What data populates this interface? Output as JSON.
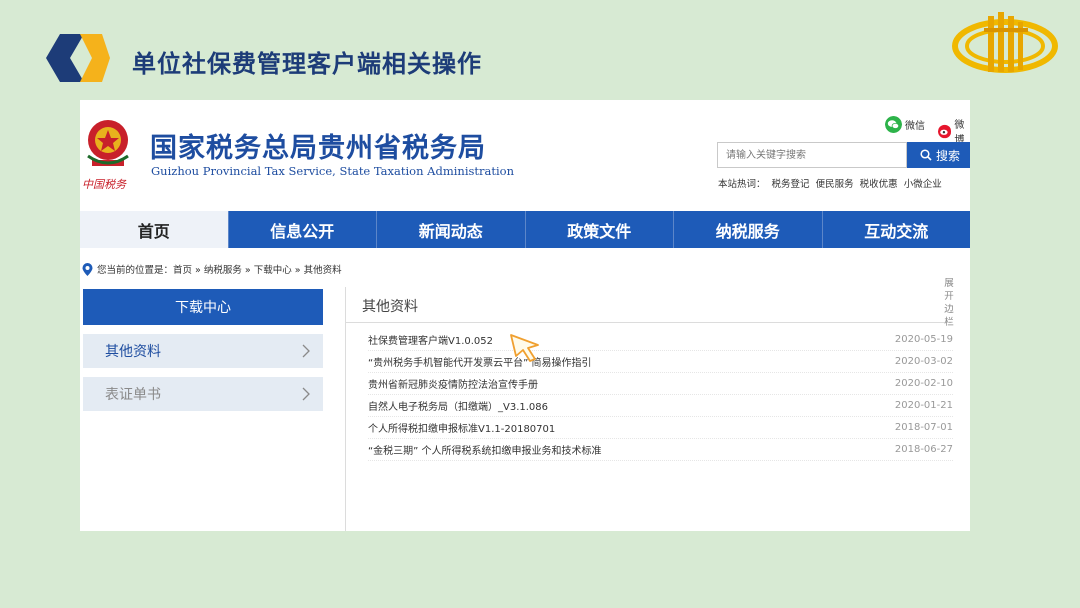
{
  "slide": {
    "title": "单位社保费管理客户端相关操作",
    "accent_colors": {
      "navy": "#1d3c78",
      "gold": "#f5b21b",
      "blue": "#1e5bb8"
    }
  },
  "site": {
    "name_cn": "国家税务总局贵州省税务局",
    "name_en": "Guizhou Provincial Tax Service, State Taxation Administration",
    "badge_text": "中国税务",
    "social": [
      {
        "icon": "wechat-icon",
        "label": "微信"
      },
      {
        "icon": "weibo-icon",
        "label": "微博"
      }
    ],
    "search": {
      "placeholder": "请输入关键字搜索",
      "button_label": "搜索"
    },
    "hot_label": "本站热词：",
    "hot_words": [
      "税务登记",
      "便民服务",
      "税收优惠",
      "小微企业"
    ],
    "nav": [
      "首页",
      "信息公开",
      "新闻动态",
      "政策文件",
      "纳税服务",
      "互动交流"
    ],
    "breadcrumb": {
      "prefix": "您当前的位置是：",
      "path": "首页 » 纳税服务 » 下载中心 » 其他资料"
    },
    "sidebar": {
      "title": "下载中心",
      "items": [
        {
          "label": "其他资料"
        },
        {
          "label": "表证单书"
        }
      ]
    },
    "content": {
      "title": "其他资料",
      "expand_label": "展开边栏",
      "documents": [
        {
          "title": "社保费管理客户端V1.0.052",
          "date": "2020-05-19"
        },
        {
          "title": "“贵州税务手机智能代开发票云平台” 简易操作指引",
          "date": "2020-03-02"
        },
        {
          "title": "贵州省新冠肺炎疫情防控法治宣传手册",
          "date": "2020-02-10"
        },
        {
          "title": "自然人电子税务局（扣缴端）_V3.1.086",
          "date": "2020-01-21"
        },
        {
          "title": "个人所得税扣缴申报标准V1.1-20180701",
          "date": "2018-07-01"
        },
        {
          "title": "“金税三期” 个人所得税系统扣缴申报业务和技术标准",
          "date": "2018-06-27"
        }
      ]
    }
  }
}
